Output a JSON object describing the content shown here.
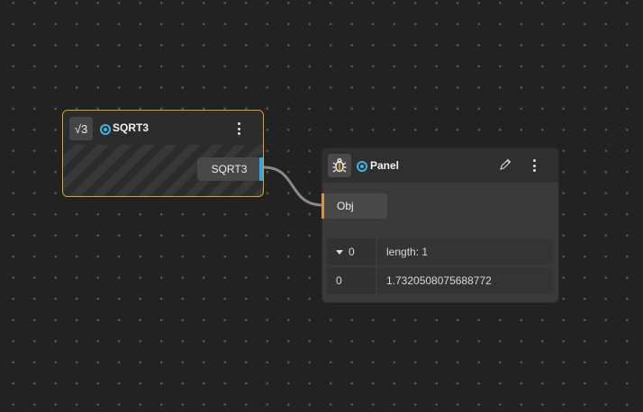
{
  "nodes": {
    "sqrt": {
      "icon": "√3",
      "title": "SQRT3",
      "output_label": "SQRT3"
    },
    "panel": {
      "icon": "bug-icon",
      "title": "Panel",
      "input_label": "Obj",
      "rows": [
        {
          "key": "0",
          "value": "length: 1",
          "expandable": true
        },
        {
          "key": "0",
          "value": "1.7320508075688772",
          "expandable": false
        }
      ]
    }
  },
  "colors": {
    "canvas_bg": "#222222",
    "selected_border": "#d8a524",
    "status_dot": "#3bb7e6",
    "output_port": "#3aa5de",
    "input_port": "#d39a3c"
  }
}
